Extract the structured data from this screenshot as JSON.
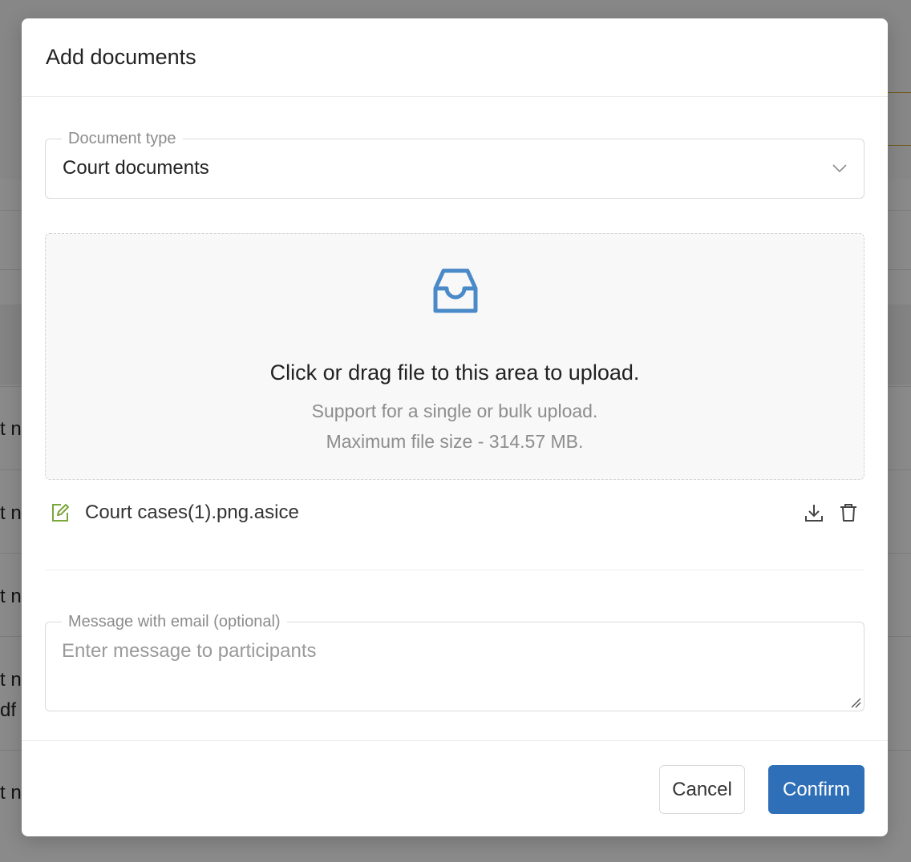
{
  "background": {
    "row_fragments": [
      "t n",
      "t n",
      "t n",
      "t n",
      "df",
      "t n"
    ]
  },
  "modal": {
    "title": "Add documents",
    "document_type": {
      "label": "Document type",
      "selected": "Court documents"
    },
    "dropzone": {
      "title": "Click or drag file to this area to upload.",
      "hint": "Support for a single or bulk upload.",
      "max_size": "Maximum file size - 314.57 MB."
    },
    "files": [
      {
        "name": "Court cases(1).png.asice"
      }
    ],
    "message": {
      "label": "Message with email (optional)",
      "placeholder": "Enter message to participants",
      "value": ""
    },
    "footer": {
      "cancel_label": "Cancel",
      "confirm_label": "Confirm"
    }
  },
  "colors": {
    "accent": "#2f6fb8",
    "icon_blue": "#4a8ac8",
    "edit_icon_green": "#7aa63a",
    "overlay": "#8a8a8a"
  },
  "icons": {
    "dropzone": "inbox-icon",
    "select": "chevron-down-icon",
    "file_status": "edit-icon",
    "file_actions": [
      "download-icon",
      "delete-icon"
    ]
  }
}
